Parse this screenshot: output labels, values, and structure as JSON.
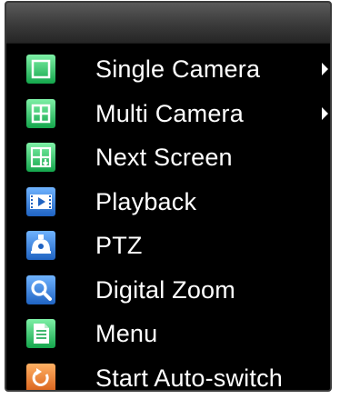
{
  "menu": {
    "items": [
      {
        "label": "Single Camera",
        "icon": "single-camera-icon",
        "has_submenu": true
      },
      {
        "label": "Multi Camera",
        "icon": "multi-camera-icon",
        "has_submenu": true
      },
      {
        "label": "Next Screen",
        "icon": "next-screen-icon",
        "has_submenu": false
      },
      {
        "label": "Playback",
        "icon": "playback-icon",
        "has_submenu": false
      },
      {
        "label": "PTZ",
        "icon": "ptz-icon",
        "has_submenu": false
      },
      {
        "label": "Digital Zoom",
        "icon": "digital-zoom-icon",
        "has_submenu": false
      },
      {
        "label": "Menu",
        "icon": "menu-icon",
        "has_submenu": false
      },
      {
        "label": "Start Auto-switch",
        "icon": "auto-switch-icon",
        "has_submenu": false
      }
    ]
  },
  "colors": {
    "background": "#000000",
    "text": "#ffffff",
    "green_icon": "#2ecc71",
    "blue_icon": "#2f7fd8",
    "orange_icon": "#e8772a"
  }
}
